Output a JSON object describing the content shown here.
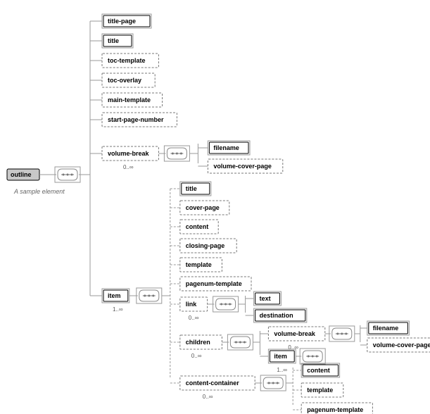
{
  "root": {
    "name": "outline",
    "note": "A sample element"
  },
  "topGroup": [
    {
      "label": "title-page",
      "solid": true
    },
    {
      "label": "title",
      "solid": true
    },
    {
      "label": "toc-template",
      "solid": false
    },
    {
      "label": "toc-overlay",
      "solid": false
    },
    {
      "label": "main-template",
      "solid": false
    },
    {
      "label": "start-page-number",
      "solid": false
    }
  ],
  "volumeBreak": {
    "label": "volume-break",
    "occ": "0..∞",
    "children": [
      {
        "label": "filename",
        "solid": true
      },
      {
        "label": "volume-cover-page",
        "solid": false
      }
    ]
  },
  "item": {
    "label": "item",
    "occ": "1..∞",
    "simple": [
      {
        "label": "title",
        "solid": true
      },
      {
        "label": "cover-page",
        "solid": false
      },
      {
        "label": "content",
        "solid": false
      },
      {
        "label": "closing-page",
        "solid": false
      },
      {
        "label": "template",
        "solid": false
      },
      {
        "label": "pagenum-template",
        "solid": false
      }
    ],
    "link": {
      "label": "link",
      "occ": "0..∞",
      "children": [
        {
          "label": "text",
          "solid": true
        },
        {
          "label": "destination",
          "solid": true
        }
      ]
    },
    "children": {
      "label": "children",
      "occ": "0..∞",
      "vb": {
        "label": "volume-break",
        "occ": "0..∞",
        "kids": [
          {
            "label": "filename",
            "solid": true
          },
          {
            "label": "volume-cover-page",
            "solid": false
          }
        ]
      },
      "it": {
        "label": "item",
        "occ": "1..∞"
      }
    },
    "cc": {
      "label": "content-container",
      "occ": "0..∞",
      "kids": [
        {
          "label": "content",
          "solid": true
        },
        {
          "label": "template",
          "solid": false
        },
        {
          "label": "pagenum-template",
          "solid": false
        }
      ]
    }
  }
}
